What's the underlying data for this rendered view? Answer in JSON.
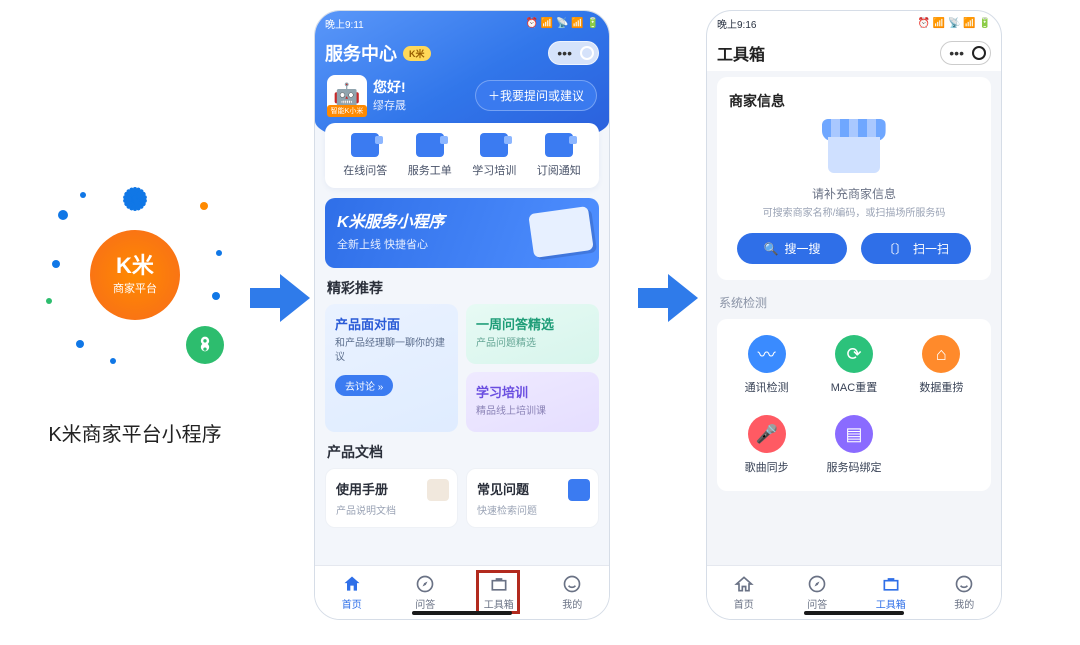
{
  "left": {
    "logo_text": "K米",
    "logo_sub": "商家平台",
    "caption": "K米商家平台小程序"
  },
  "phone1": {
    "status_time": "晚上9:11",
    "app_title": "服务中心",
    "greeting_hi": "您好!",
    "greeting_name": "缪存晟",
    "bot_tag": "智能K小米",
    "ask_button": "＋我要提问或建议",
    "quick": [
      {
        "label": "在线问答"
      },
      {
        "label": "服务工单"
      },
      {
        "label": "学习培训"
      },
      {
        "label": "订阅通知"
      }
    ],
    "banner_line1": "K米服务小程序",
    "banner_line2": "全新上线 快捷省心",
    "section_rec": "精彩推荐",
    "rec_a_title": "产品面对面",
    "rec_a_sub": "和产品经理聊一聊你的建议",
    "rec_a_chip": "去讨论 »",
    "rec_b_title": "一周问答精选",
    "rec_b_sub": "产品问题精选",
    "rec_c_title": "学习培训",
    "rec_c_sub": "精品线上培训课",
    "section_doc": "产品文档",
    "doc_a_title": "使用手册",
    "doc_a_sub": "产品说明文档",
    "doc_b_title": "常见问题",
    "doc_b_sub": "快速检索问题",
    "tabs": {
      "home": "首页",
      "qa": "问答",
      "toolbox": "工具箱",
      "mine": "我的"
    }
  },
  "phone2": {
    "status_time": "晚上9:16",
    "page_title": "工具箱",
    "merchant_title": "商家信息",
    "merchant_hint1": "请补充商家信息",
    "merchant_hint2": "可搜索商家名称/编码，或扫描场所服务码",
    "search_btn": "搜一搜",
    "scan_btn": "扫一扫",
    "sys_label": "系统检测",
    "sys_items": [
      {
        "label": "通讯检测",
        "color": "c-blue"
      },
      {
        "label": "MAC重置",
        "color": "c-green"
      },
      {
        "label": "数据重捞",
        "color": "c-orange"
      },
      {
        "label": "歌曲同步",
        "color": "c-red"
      },
      {
        "label": "服务码绑定",
        "color": "c-purple"
      }
    ],
    "tabs": {
      "home": "首页",
      "qa": "问答",
      "toolbox": "工具箱",
      "mine": "我的"
    }
  }
}
